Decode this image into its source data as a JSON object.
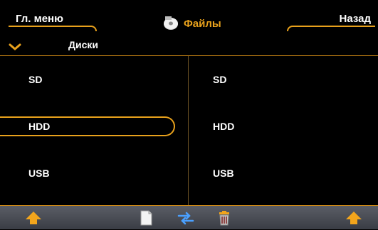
{
  "header": {
    "main_menu_label": "Гл. меню",
    "title": "Файлы",
    "back_label": "Назад"
  },
  "drive_selector": {
    "label": "Диски"
  },
  "left_pane": {
    "items": [
      "SD",
      "HDD",
      "USB"
    ],
    "selected": "HDD"
  },
  "right_pane": {
    "items": [
      "SD",
      "HDD",
      "USB"
    ]
  },
  "toolbar": {
    "icons": [
      "up-arrow-icon",
      "file-icon",
      "move-arrows-icon",
      "trash-icon",
      "up-arrow-icon"
    ]
  },
  "colors": {
    "accent": "#e8a11c",
    "background": "#000000",
    "toolbar": "#4a4d55",
    "move_arrows": "#4aa0ff"
  }
}
